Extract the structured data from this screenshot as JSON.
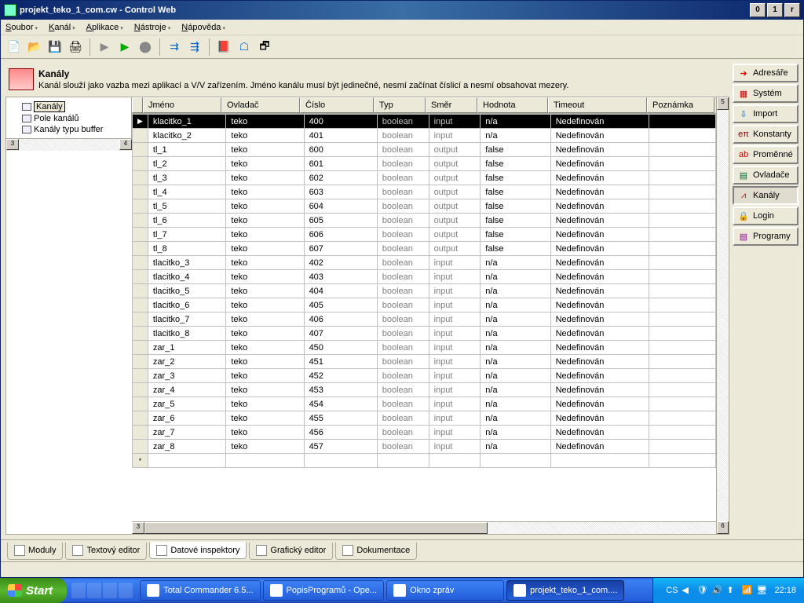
{
  "title": "projekt_teko_1_com.cw - Control Web",
  "menus": [
    "Soubor",
    "Kanál",
    "Aplikace",
    "Nástroje",
    "Nápověda"
  ],
  "header": {
    "title": "Kanály",
    "desc": "Kanál slouží jako vazba mezi aplikací a V/V zařízením. Jméno kanálu musí být jedinečné, nesmí začínat číslicí a nesmí obsahovat mezery."
  },
  "tree": [
    {
      "label": "Kanály",
      "selected": true
    },
    {
      "label": "Pole kanálů",
      "selected": false
    },
    {
      "label": "Kanály typu buffer",
      "selected": false
    }
  ],
  "columns": [
    "Jméno",
    "Ovladač",
    "Číslo",
    "Typ",
    "Směr",
    "Hodnota",
    "Timeout",
    "Poznámka"
  ],
  "rows": [
    {
      "sel": true,
      "jmeno": "klacitko_1",
      "ovl": "teko",
      "cislo": "400",
      "typ": "boolean",
      "smer": "input",
      "hod": "n/a",
      "tmo": "Nedefinován",
      "poz": ""
    },
    {
      "jmeno": "klacitko_2",
      "ovl": "teko",
      "cislo": "401",
      "typ": "boolean",
      "smer": "input",
      "hod": "n/a",
      "tmo": "Nedefinován",
      "poz": ""
    },
    {
      "jmeno": "tl_1",
      "ovl": "teko",
      "cislo": "600",
      "typ": "boolean",
      "smer": "output",
      "hod": "false",
      "tmo": "Nedefinován",
      "poz": ""
    },
    {
      "jmeno": "tl_2",
      "ovl": "teko",
      "cislo": "601",
      "typ": "boolean",
      "smer": "output",
      "hod": "false",
      "tmo": "Nedefinován",
      "poz": ""
    },
    {
      "jmeno": "tl_3",
      "ovl": "teko",
      "cislo": "602",
      "typ": "boolean",
      "smer": "output",
      "hod": "false",
      "tmo": "Nedefinován",
      "poz": ""
    },
    {
      "jmeno": "tl_4",
      "ovl": "teko",
      "cislo": "603",
      "typ": "boolean",
      "smer": "output",
      "hod": "false",
      "tmo": "Nedefinován",
      "poz": ""
    },
    {
      "jmeno": "tl_5",
      "ovl": "teko",
      "cislo": "604",
      "typ": "boolean",
      "smer": "output",
      "hod": "false",
      "tmo": "Nedefinován",
      "poz": ""
    },
    {
      "jmeno": "tl_6",
      "ovl": "teko",
      "cislo": "605",
      "typ": "boolean",
      "smer": "output",
      "hod": "false",
      "tmo": "Nedefinován",
      "poz": ""
    },
    {
      "jmeno": "tl_7",
      "ovl": "teko",
      "cislo": "606",
      "typ": "boolean",
      "smer": "output",
      "hod": "false",
      "tmo": "Nedefinován",
      "poz": ""
    },
    {
      "jmeno": "tl_8",
      "ovl": "teko",
      "cislo": "607",
      "typ": "boolean",
      "smer": "output",
      "hod": "false",
      "tmo": "Nedefinován",
      "poz": ""
    },
    {
      "jmeno": "tlacitko_3",
      "ovl": "teko",
      "cislo": "402",
      "typ": "boolean",
      "smer": "input",
      "hod": "n/a",
      "tmo": "Nedefinován",
      "poz": ""
    },
    {
      "jmeno": "tlacitko_4",
      "ovl": "teko",
      "cislo": "403",
      "typ": "boolean",
      "smer": "input",
      "hod": "n/a",
      "tmo": "Nedefinován",
      "poz": ""
    },
    {
      "jmeno": "tlacitko_5",
      "ovl": "teko",
      "cislo": "404",
      "typ": "boolean",
      "smer": "input",
      "hod": "n/a",
      "tmo": "Nedefinován",
      "poz": ""
    },
    {
      "jmeno": "tlacitko_6",
      "ovl": "teko",
      "cislo": "405",
      "typ": "boolean",
      "smer": "input",
      "hod": "n/a",
      "tmo": "Nedefinován",
      "poz": ""
    },
    {
      "jmeno": "tlacitko_7",
      "ovl": "teko",
      "cislo": "406",
      "typ": "boolean",
      "smer": "input",
      "hod": "n/a",
      "tmo": "Nedefinován",
      "poz": ""
    },
    {
      "jmeno": "tlacitko_8",
      "ovl": "teko",
      "cislo": "407",
      "typ": "boolean",
      "smer": "input",
      "hod": "n/a",
      "tmo": "Nedefinován",
      "poz": ""
    },
    {
      "jmeno": "zar_1",
      "ovl": "teko",
      "cislo": "450",
      "typ": "boolean",
      "smer": "input",
      "hod": "n/a",
      "tmo": "Nedefinován",
      "poz": ""
    },
    {
      "jmeno": "zar_2",
      "ovl": "teko",
      "cislo": "451",
      "typ": "boolean",
      "smer": "input",
      "hod": "n/a",
      "tmo": "Nedefinován",
      "poz": ""
    },
    {
      "jmeno": "zar_3",
      "ovl": "teko",
      "cislo": "452",
      "typ": "boolean",
      "smer": "input",
      "hod": "n/a",
      "tmo": "Nedefinován",
      "poz": ""
    },
    {
      "jmeno": "zar_4",
      "ovl": "teko",
      "cislo": "453",
      "typ": "boolean",
      "smer": "input",
      "hod": "n/a",
      "tmo": "Nedefinován",
      "poz": ""
    },
    {
      "jmeno": "zar_5",
      "ovl": "teko",
      "cislo": "454",
      "typ": "boolean",
      "smer": "input",
      "hod": "n/a",
      "tmo": "Nedefinován",
      "poz": ""
    },
    {
      "jmeno": "zar_6",
      "ovl": "teko",
      "cislo": "455",
      "typ": "boolean",
      "smer": "input",
      "hod": "n/a",
      "tmo": "Nedefinován",
      "poz": ""
    },
    {
      "jmeno": "zar_7",
      "ovl": "teko",
      "cislo": "456",
      "typ": "boolean",
      "smer": "input",
      "hod": "n/a",
      "tmo": "Nedefinován",
      "poz": ""
    },
    {
      "jmeno": "zar_8",
      "ovl": "teko",
      "cislo": "457",
      "typ": "boolean",
      "smer": "input",
      "hod": "n/a",
      "tmo": "Nedefinován",
      "poz": ""
    }
  ],
  "sidebar": [
    {
      "label": "Adresáře",
      "icon": "➜",
      "color": "#d00"
    },
    {
      "label": "Systém",
      "icon": "▦",
      "color": "#c00"
    },
    {
      "label": "Import",
      "icon": "⇩",
      "color": "#06c"
    },
    {
      "label": "Konstanty",
      "icon": "eπ",
      "color": "#800"
    },
    {
      "label": "Proměnné",
      "icon": "ab",
      "color": "#c00"
    },
    {
      "label": "Ovladače",
      "icon": "▤",
      "color": "#063"
    },
    {
      "label": "Kanály",
      "icon": "⩘",
      "color": "#c00",
      "pressed": true
    },
    {
      "label": "Login",
      "icon": "🔒",
      "color": "#800"
    },
    {
      "label": "Programy",
      "icon": "▤",
      "color": "#808"
    }
  ],
  "bottom_tabs": [
    {
      "label": "Moduly"
    },
    {
      "label": "Textový editor"
    },
    {
      "label": "Datové inspektory",
      "active": true
    },
    {
      "label": "Grafický editor"
    },
    {
      "label": "Dokumentace"
    }
  ],
  "taskbar": {
    "start": "Start",
    "tasks": [
      {
        "label": "Total Commander 6.5..."
      },
      {
        "label": "PopisProgramů - Ope..."
      },
      {
        "label": "Okno zpráv"
      },
      {
        "label": "projekt_teko_1_com....",
        "active": true
      }
    ],
    "lang": "CS",
    "clock": "22:18"
  }
}
